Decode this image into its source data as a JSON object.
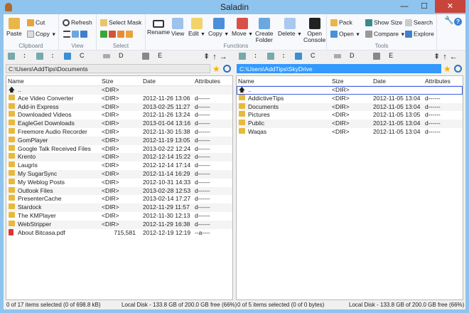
{
  "window": {
    "title": "Saladin",
    "minimize": "—",
    "maximize": "☐",
    "close": "✕"
  },
  "ribbon": {
    "clipboard": {
      "label": "Clipboard",
      "paste": "Paste",
      "cut": "Cut",
      "copy": "Copy"
    },
    "view": {
      "label": "View",
      "refresh": "Refresh"
    },
    "select": {
      "label": "Select",
      "select_mask": "Select Mask"
    },
    "functions": {
      "label": "Functions",
      "rename": "Rename",
      "view": "View",
      "edit": "Edit",
      "copy": "Copy",
      "move": "Move",
      "create_folder_1": "Create",
      "create_folder_2": "Folder",
      "delete": "Delete",
      "open_console_1": "Open",
      "open_console_2": "Console"
    },
    "tools": {
      "label": "Tools",
      "pack": "Pack",
      "show_size": "Show Size",
      "search": "Search",
      "open": "Open",
      "compare": "Compare",
      "explore": "Explore"
    }
  },
  "drives": {
    "net1": ":",
    "net2": ":",
    "c": "C",
    "d": "D",
    "e": "E"
  },
  "left": {
    "path": "C:\\Users\\AddTips\\Documents",
    "columns": [
      "Name",
      "Size",
      "Date",
      "Attributes"
    ],
    "rows": [
      {
        "name": "..",
        "size": "<DIR>",
        "date": "",
        "attr": "",
        "icon": "up-arrow"
      },
      {
        "name": "Ace Video Converter",
        "size": "<DIR>",
        "date": "2012-11-26 13:06",
        "attr": "d------",
        "icon": "folder"
      },
      {
        "name": "Add-in Express",
        "size": "<DIR>",
        "date": "2013-02-25 11:27",
        "attr": "d------",
        "icon": "folder"
      },
      {
        "name": "Downloaded Videos",
        "size": "<DIR>",
        "date": "2012-11-26 13:24",
        "attr": "d------",
        "icon": "folder"
      },
      {
        "name": "EagleGet Downloads",
        "size": "<DIR>",
        "date": "2013-01-04 13:16",
        "attr": "d------",
        "icon": "folder"
      },
      {
        "name": "Freemore Audio Recorder",
        "size": "<DIR>",
        "date": "2012-11-30 15:38",
        "attr": "d------",
        "icon": "folder"
      },
      {
        "name": "GomPlayer",
        "size": "<DIR>",
        "date": "2012-11-19 13:05",
        "attr": "d------",
        "icon": "folder"
      },
      {
        "name": "Google Talk Received Files",
        "size": "<DIR>",
        "date": "2013-02-22 12:24",
        "attr": "d------",
        "icon": "folder"
      },
      {
        "name": "Krento",
        "size": "<DIR>",
        "date": "2012-12-14 15:22",
        "attr": "d------",
        "icon": "folder"
      },
      {
        "name": "Laugris",
        "size": "<DIR>",
        "date": "2012-12-14 17:14",
        "attr": "d------",
        "icon": "folder"
      },
      {
        "name": "My SugarSync",
        "size": "<DIR>",
        "date": "2012-11-14 16:29",
        "attr": "d------",
        "icon": "folder"
      },
      {
        "name": "My Weblog Posts",
        "size": "<DIR>",
        "date": "2012-10-31 14:33",
        "attr": "d------",
        "icon": "folder"
      },
      {
        "name": "Outlook Files",
        "size": "<DIR>",
        "date": "2013-02-28 12:53",
        "attr": "d------",
        "icon": "folder"
      },
      {
        "name": "PresenterCache",
        "size": "<DIR>",
        "date": "2013-02-14 17:27",
        "attr": "d------",
        "icon": "folder"
      },
      {
        "name": "Stardock",
        "size": "<DIR>",
        "date": "2012-11-29 11:57",
        "attr": "d------",
        "icon": "folder"
      },
      {
        "name": "The KMPlayer",
        "size": "<DIR>",
        "date": "2012-11-30 12:13",
        "attr": "d------",
        "icon": "folder"
      },
      {
        "name": "WebStripper",
        "size": "<DIR>",
        "date": "2012-11-29 16:38",
        "attr": "d------",
        "icon": "folder"
      },
      {
        "name": "About Bitcasa.pdf",
        "size": "715,581",
        "date": "2012-12-19 12:19",
        "attr": "--a----",
        "icon": "pdf"
      }
    ],
    "status_selection": "0 of 17 items selected (0 of 698.8 kB)",
    "status_disk": "Local Disk - 133.8 GB of 200.0 GB free (66%)"
  },
  "right": {
    "path": "C:\\Users\\AddTips\\SkyDrive",
    "columns": [
      "Name",
      "Size",
      "Date",
      "Attributes"
    ],
    "rows": [
      {
        "name": "..",
        "size": "<DIR>",
        "date": "",
        "attr": "",
        "icon": "up-arrow"
      },
      {
        "name": "AddictiveTips",
        "size": "<DIR>",
        "date": "2012-11-05 13:04",
        "attr": "d------",
        "icon": "folder"
      },
      {
        "name": "Documents",
        "size": "<DIR>",
        "date": "2012-11-05 13:04",
        "attr": "d------",
        "icon": "folder"
      },
      {
        "name": "Pictures",
        "size": "<DIR>",
        "date": "2012-11-05 13:05",
        "attr": "d------",
        "icon": "folder"
      },
      {
        "name": "Public",
        "size": "<DIR>",
        "date": "2012-11-05 13:04",
        "attr": "d------",
        "icon": "folder"
      },
      {
        "name": "Waqas",
        "size": "<DIR>",
        "date": "2012-11-05 13:04",
        "attr": "d------",
        "icon": "folder"
      }
    ],
    "status_selection": "0 of 5 items selected (0 of 0 bytes)",
    "status_disk": "Local Disk - 133.8 GB of 200.0 GB free (66%)"
  }
}
